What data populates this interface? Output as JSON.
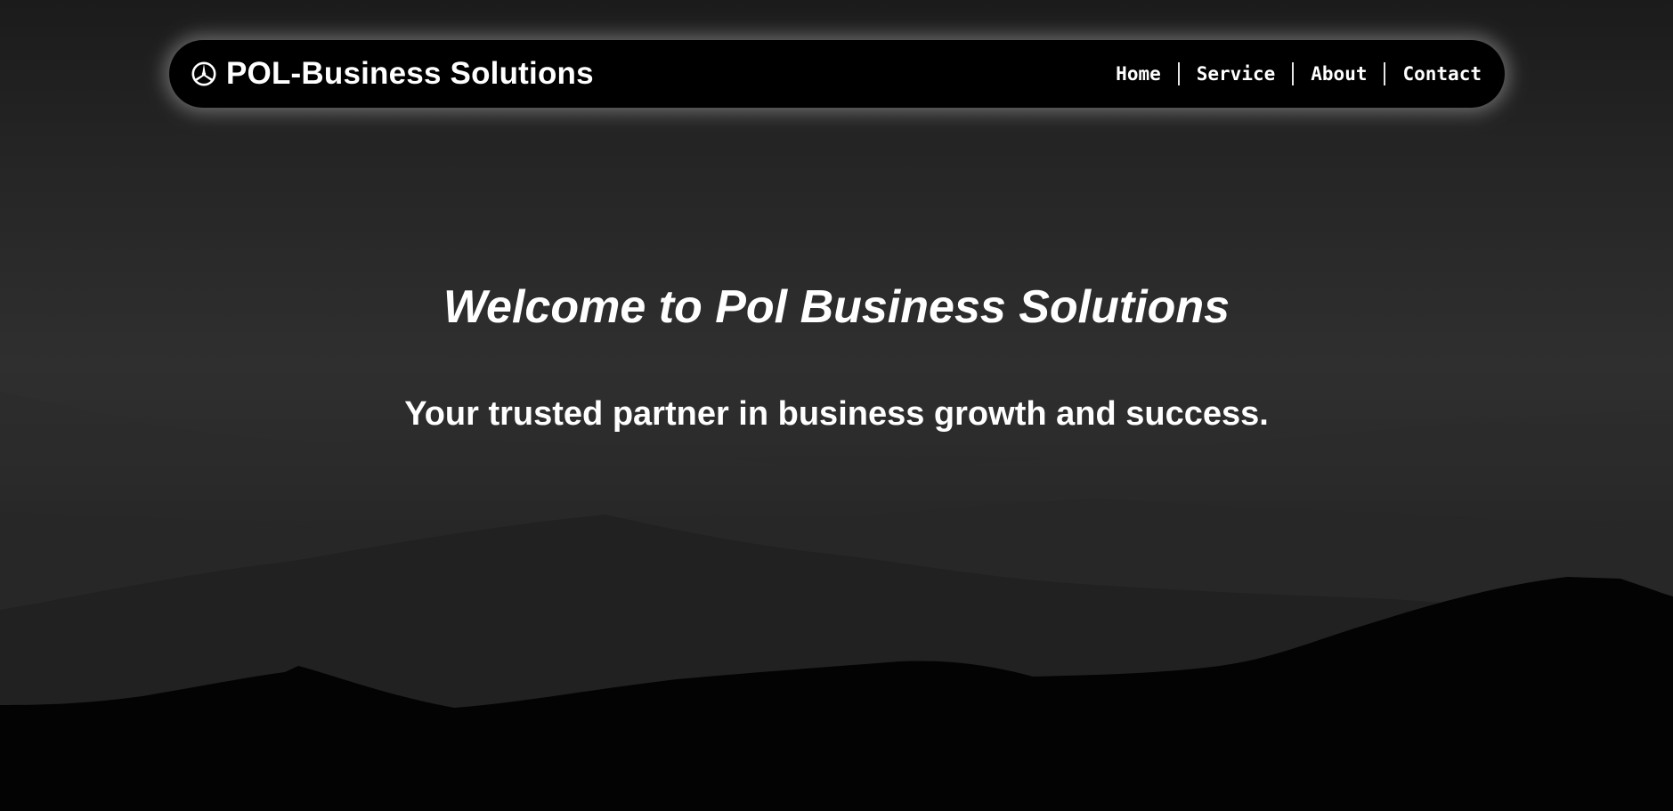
{
  "brand": {
    "icon": "mercedes-star-circle-icon",
    "name": "POL-Business Solutions"
  },
  "nav": {
    "items": [
      {
        "label": "Home"
      },
      {
        "label": "Service"
      },
      {
        "label": "About"
      },
      {
        "label": "Contact"
      }
    ]
  },
  "hero": {
    "title": "Welcome to Pol Business Solutions",
    "subtitle": "Your trusted partner in business growth and success."
  },
  "colors": {
    "navbar_bg": "#000000",
    "text": "#ffffff",
    "page_top": "#1b1b1b",
    "page_bottom": "#000000"
  }
}
